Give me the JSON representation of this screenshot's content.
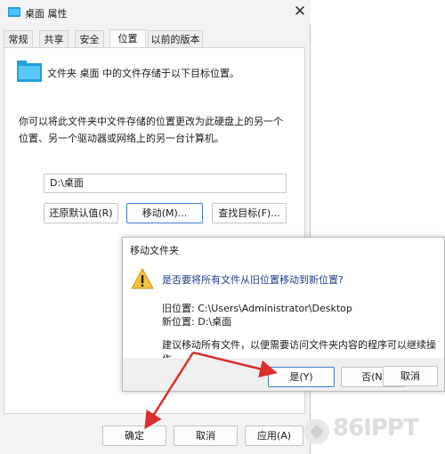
{
  "window": {
    "title": "桌面 属性",
    "close_glyph": "✕",
    "tabs": [
      {
        "label": "常规",
        "active": false
      },
      {
        "label": "共享",
        "active": false
      },
      {
        "label": "安全",
        "active": false
      },
      {
        "label": "位置",
        "active": true
      },
      {
        "label": "以前的版本",
        "active": false
      }
    ],
    "location_description": "文件夹 桌面 中的文件存储于以下目标位置。",
    "info_line1": "你可以将此文件夹中文件存储的位置更改为此硬盘上的另一个",
    "info_line2": "位置、另一个驱动器或网络上的另一台计算机。",
    "path_value": "D:\\桌面",
    "restore_default_label": "还原默认值(R)",
    "move_label": "移动(M)...",
    "find_target_label": "查找目标(F)...",
    "ok_label": "确定",
    "cancel_label": "取消",
    "apply_label": "应用(A)"
  },
  "dialog": {
    "title": "移动文件夹",
    "question": "是否要将所有文件从旧位置移动到新位置?",
    "old_location": "旧位置: C:\\Users\\Administrator\\Desktop",
    "new_location": "新位置: D:\\桌面",
    "advice": "建议移动所有文件，以便需要访问文件夹内容的程序可以继续操作。",
    "yes_label": "是(Y)",
    "no_label": "否(N)",
    "cancel_label": "取消"
  },
  "annotation": {
    "arrow_color": "#d9302c"
  },
  "watermark": {
    "text": "86IPPT"
  }
}
